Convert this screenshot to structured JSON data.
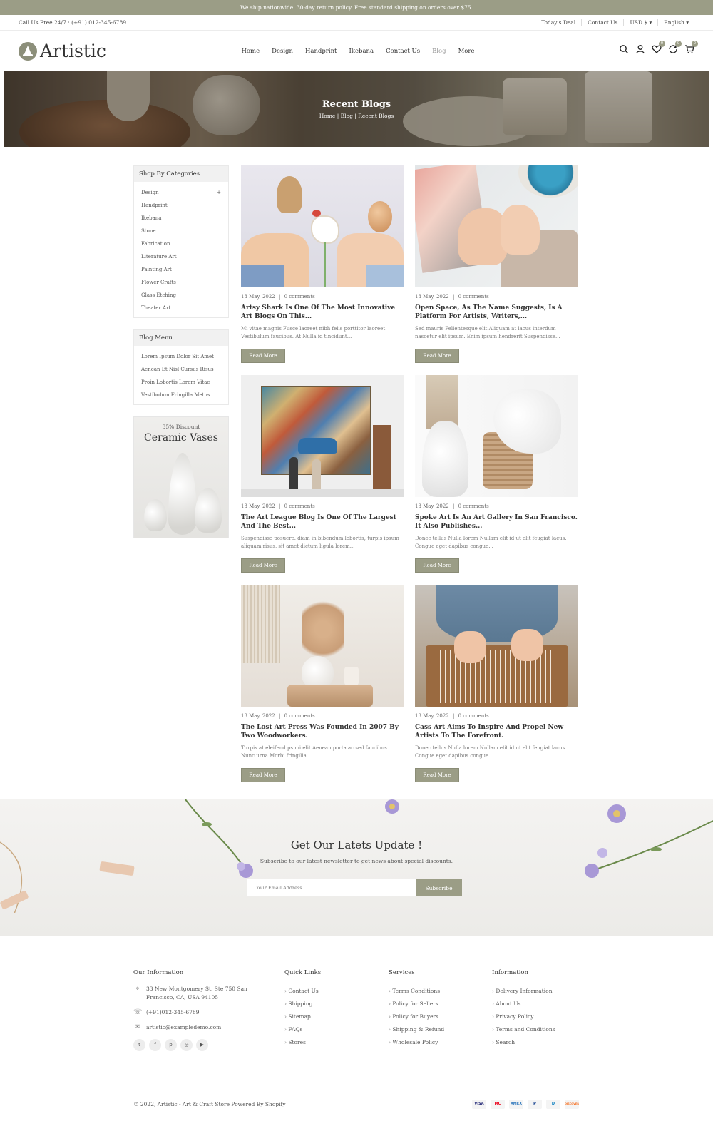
{
  "announcement": "We ship nationwide. 30-day return policy. Free standard shipping on orders over $75.",
  "topbar": {
    "phone": "Call Us Free 24/7 : (+91) 012-345-6789",
    "links": [
      "Today's Deal",
      "Contact Us",
      "USD $ ▾",
      "English ▾"
    ]
  },
  "header": {
    "logo": "Artistic",
    "nav": [
      "Home",
      "Design",
      "Handprint",
      "Ikebana",
      "Contact Us",
      "Blog",
      "More"
    ],
    "active_nav": "Blog",
    "wishlist_count": "0",
    "compare_count": "0",
    "cart_count": "0"
  },
  "hero": {
    "title": "Recent Blogs",
    "breadcrumb": "Home |  Blog  |  Recent Blogs"
  },
  "sidebar": {
    "categories_title": "Shop By Categories",
    "categories": [
      "Design",
      "Handprint",
      "Ikebana",
      "Stone",
      "Fabrication",
      "Literature Art",
      "Painting Art",
      "Flower Crafts",
      "Glass Etching",
      "Theater Art"
    ],
    "expand_icon": "+",
    "blog_menu_title": "Blog Menu",
    "blog_menu": [
      "Lorem Ipsum Dolor Sit Amet",
      "Aenean Et Nisl Cursus Risus",
      "Proin Lobortis Lorem Vitae",
      "Vestibulum Fringilla Metus"
    ],
    "promo": {
      "subtitle": "35% Discount",
      "title": "Ceramic Vases"
    }
  },
  "posts": [
    {
      "date": "13 May, 2022",
      "comments": "0 comments",
      "title": "Artsy Shark Is One Of The Most Innovative Art Blogs On This...",
      "excerpt": "Mi vitae magnis Fusce laoreet nibh felis porttitor laoreet Vestibulum faucibus. At Nulla id tincidunt...",
      "button": "Read More",
      "image": "easter-craft-photo"
    },
    {
      "date": "13 May, 2022",
      "comments": "0 comments",
      "title": "Open Space, As The Name Suggests, Is A Platform For Artists, Writers,...",
      "excerpt": "Sed mauris Pellentesque elit Aliquam at lacus interdum nascetur elit ipsum. Enim ipsum hendrerit Suspendisse...",
      "button": "Read More",
      "image": "knitting-photo"
    },
    {
      "date": "13 May, 2022",
      "comments": "0 comments",
      "title": "The Art League Blog Is One Of The Largest And The Best...",
      "excerpt": "Suspendisse posuere. diam in bibendum lobortis, turpis ipsum aliquam risus, sit amet dictum ligula lorem...",
      "button": "Read More",
      "image": "gallery-painting-photo"
    },
    {
      "date": "13 May, 2022",
      "comments": "0 comments",
      "title": "Spoke Art Is An Art Gallery In San Francisco. It Also Publishes...",
      "excerpt": "Donec tellus Nulla lorem Nullam elit id ut elit feugiat lacus. Congue eget dapibus congue...",
      "button": "Read More",
      "image": "dove-vase-photo"
    },
    {
      "date": "13 May, 2022",
      "comments": "0 comments",
      "title": "The Lost Art Press Was Founded In 2007 By Two Woodworkers.",
      "excerpt": "Turpis at eleifend ps mi elit Aenean porta ac sed faucibus. Nunc urna Morbi fringilla...",
      "button": "Read More",
      "image": "dried-flowers-vase-photo"
    },
    {
      "date": "13 May, 2022",
      "comments": "0 comments",
      "title": "Cass Art Aims To Inspire And Propel New Artists To The Forefront.",
      "excerpt": "Donec tellus Nulla lorem Nullam elit id ut elit feugiat lacus. Congue eget dapibus congue...",
      "button": "Read More",
      "image": "weaving-loom-photo"
    }
  ],
  "newsletter": {
    "title": "Get Our Latets Update !",
    "subtitle": "Subscribe to our latest newsletter to get news about special discounts.",
    "placeholder": "Your Email Address",
    "button": "Subscribe"
  },
  "footer": {
    "info_title": "Our Information",
    "address": "33 New Montgomery St. Ste 750 San Francisco, CA, USA 94105",
    "phone": "(+91)012-345-6789",
    "email": "artistic@exampledemo.com",
    "socials": [
      "twitter-icon",
      "facebook-icon",
      "pinterest-icon",
      "instagram-icon",
      "youtube-icon"
    ],
    "quick_links_title": "Quick Links",
    "quick_links": [
      "Contact Us",
      "Shipping",
      "Sitemap",
      "FAQs",
      "Stores"
    ],
    "services_title": "Services",
    "services": [
      "Terms Conditions",
      "Policy for Sellers",
      "Policy for Buyers",
      "Shipping & Refund",
      "Wholesale Policy"
    ],
    "information_title": "Information",
    "information": [
      "Delivery Information",
      "About Us",
      "Privacy Policy",
      "Terms and Conditions",
      "Search"
    ],
    "copyright": "© 2022, Artistic - Art & Craft Store Powered By Shopify",
    "payments": [
      {
        "name": "VISA",
        "color": "#1a1f71"
      },
      {
        "name": "MC",
        "color": "#eb001b"
      },
      {
        "name": "AMEX",
        "color": "#2e77bc"
      },
      {
        "name": "P",
        "color": "#003087"
      },
      {
        "name": "D",
        "color": "#0079be"
      },
      {
        "name": "DISCOVER",
        "color": "#f76f20"
      }
    ]
  },
  "theme": {
    "accent": "#9b9d86"
  }
}
